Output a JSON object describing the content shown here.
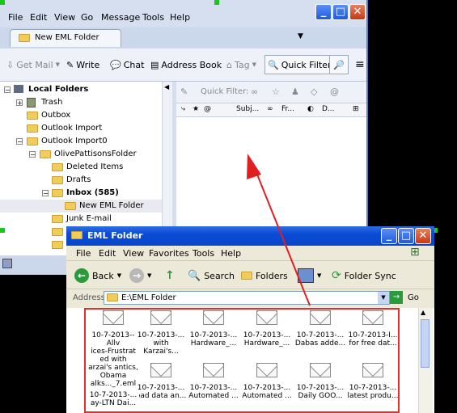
{
  "thunderbird": {
    "menu": [
      "File",
      "Edit",
      "View",
      "Go",
      "Message",
      "Tools",
      "Help"
    ],
    "tab_label": "New EML Folder",
    "toolbar": {
      "get_mail": "Get Mail",
      "write": "Write",
      "chat": "Chat",
      "address_book": "Address Book",
      "tag": "Tag",
      "quick_filter": "Quick Filter"
    },
    "folders": [
      {
        "label": "Local Folders",
        "bold": true
      },
      {
        "label": "Trash"
      },
      {
        "label": "Outbox"
      },
      {
        "label": "Outlook Import"
      },
      {
        "label": "Outlook Import0"
      },
      {
        "label": "OlivePattisonsFolder"
      },
      {
        "label": "Deleted Items"
      },
      {
        "label": "Drafts"
      },
      {
        "label": "Inbox (585)",
        "bold": true
      },
      {
        "label": "New EML Folder",
        "selected": true
      },
      {
        "label": "Junk E-mail"
      }
    ],
    "quick_filter_label": "Quick Filter:",
    "columns": [
      "Subj...",
      "Fr...",
      "D..."
    ]
  },
  "explorer": {
    "title": "EML Folder",
    "menu": [
      "File",
      "Edit",
      "View",
      "Favorites",
      "Tools",
      "Help"
    ],
    "toolbar": {
      "back": "Back",
      "search": "Search",
      "folders": "Folders",
      "folder_sync": "Folder Sync"
    },
    "address_label": "Address",
    "address_value": "E:\\EML Folder",
    "go_label": "Go",
    "files": [
      "10-7-2013--Allv\nices-Frustrat\ned with\narzai's antics,\nObama\nalks..._7.eml",
      "10-7-2013-...\nwith Karzai's...",
      "10-7-2013-...\nHardware_...",
      "10-7-2013-...\nHardware_...",
      "10-7-2013-...\nDabas adde...",
      "10-7-2013-I...\nfor free dat...",
      "10-7-2013-...\nay-LTN Dai...",
      "10-7-2013-...\nbad data an...",
      "10-7-2013-...\nAutomated ...",
      "10-7-2013-...\nAutomated ...",
      "10-7-2013-...\nDaily GOO...",
      "10-7-2013-...\nlatest produ..."
    ]
  },
  "colors": {
    "thunderbird_frame": "#d5dfef",
    "xp_title": "#0a4bd6",
    "selection_outline": "#e03030",
    "arrow": "#e02020",
    "folder_yellow": "#f2cc5a"
  }
}
